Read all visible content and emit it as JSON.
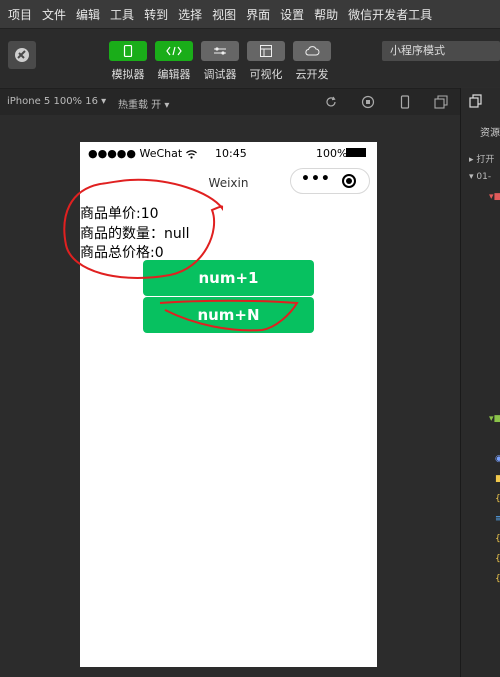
{
  "menu": [
    "项目",
    "文件",
    "编辑",
    "工具",
    "转到",
    "选择",
    "视图",
    "界面",
    "设置",
    "帮助",
    "微信开发者工具"
  ],
  "toolbar": {
    "simulator": "模拟器",
    "editor": "编辑器",
    "debugger": "调试器",
    "visual": "可视化",
    "cloud": "云开发",
    "mode": "小程序模式"
  },
  "simbar": {
    "device": "iPhone 5 100% 16 ▾",
    "reload": "热重载 开 ▾"
  },
  "phone": {
    "carrier": "●●●●● WeChat",
    "time": "10:45",
    "battery": "100%",
    "title": "Weixin",
    "capsule_more": "•••",
    "info": {
      "price": "商品单价:10",
      "count": "商品的数量：null",
      "total": "商品总价格:0"
    },
    "buttons": {
      "plus_one": "num+1",
      "plus_n": "num+N"
    }
  },
  "right_panel": {
    "resource_label": "资源",
    "tree": [
      "打开",
      "01-"
    ]
  },
  "colors": {
    "accent_green": "#07c160",
    "toolbar_green": "#1aad19",
    "annotation_red": "#e02020"
  },
  "icons": [
    "mobile-icon",
    "code-icon",
    "sliders-icon",
    "layout-icon",
    "cloud-icon",
    "refresh-icon",
    "stop-icon",
    "phone-icon",
    "window-icon",
    "copy-icon",
    "chevron-icon",
    "wifi-icon",
    "battery-icon",
    "close-target-icon"
  ]
}
